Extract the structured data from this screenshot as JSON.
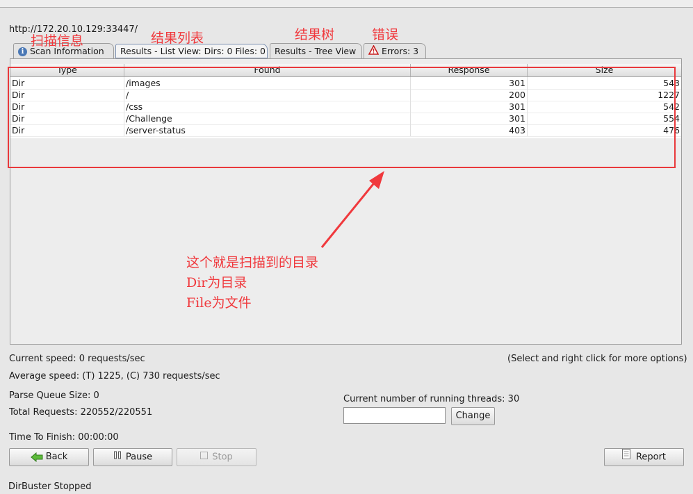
{
  "url": "http://172.20.10.129:33447/",
  "tabs": [
    {
      "label": "Scan Information",
      "icon": "info-icon"
    },
    {
      "label": "Results - List View: Dirs: 0 Files: 0",
      "selected": true
    },
    {
      "label": "Results - Tree View"
    },
    {
      "label": "Errors: 3",
      "icon": "warning-icon"
    }
  ],
  "table": {
    "columns": [
      "Type",
      "Found",
      "Response",
      "Size"
    ],
    "rows": [
      {
        "type": "Dir",
        "found": "/images",
        "response": "301",
        "size": "543"
      },
      {
        "type": "Dir",
        "found": "/",
        "response": "200",
        "size": "1227"
      },
      {
        "type": "Dir",
        "found": "/css",
        "response": "301",
        "size": "542"
      },
      {
        "type": "Dir",
        "found": "/Challenge",
        "response": "301",
        "size": "554"
      },
      {
        "type": "Dir",
        "found": "/server-status",
        "response": "403",
        "size": "476"
      }
    ]
  },
  "annotations": {
    "scan_info": "扫描信息",
    "result_list": "结果列表",
    "result_tree": "结果树",
    "errors": "错误",
    "note_line1": "这个就是扫描到的目录",
    "note_line2": "Dir为目录",
    "note_line3": "File为文件",
    "color": "#f0393d"
  },
  "status": {
    "current_speed": "Current speed: 0 requests/sec",
    "select_hint": "(Select and right click for more options)",
    "average_speed": "Average speed: (T) 1225, (C) 730 requests/sec",
    "parse_queue": "Parse Queue Size: 0",
    "total_requests": "Total Requests: 220552/220551",
    "threads": "Current number of running threads: 30",
    "time_to_finish": "Time To Finish: 00:00:00",
    "footer": "DirBuster Stopped"
  },
  "inputs": {
    "threads_value": ""
  },
  "buttons": {
    "change": "Change",
    "back": "Back",
    "pause": "Pause",
    "stop": "Stop",
    "report": "Report"
  }
}
